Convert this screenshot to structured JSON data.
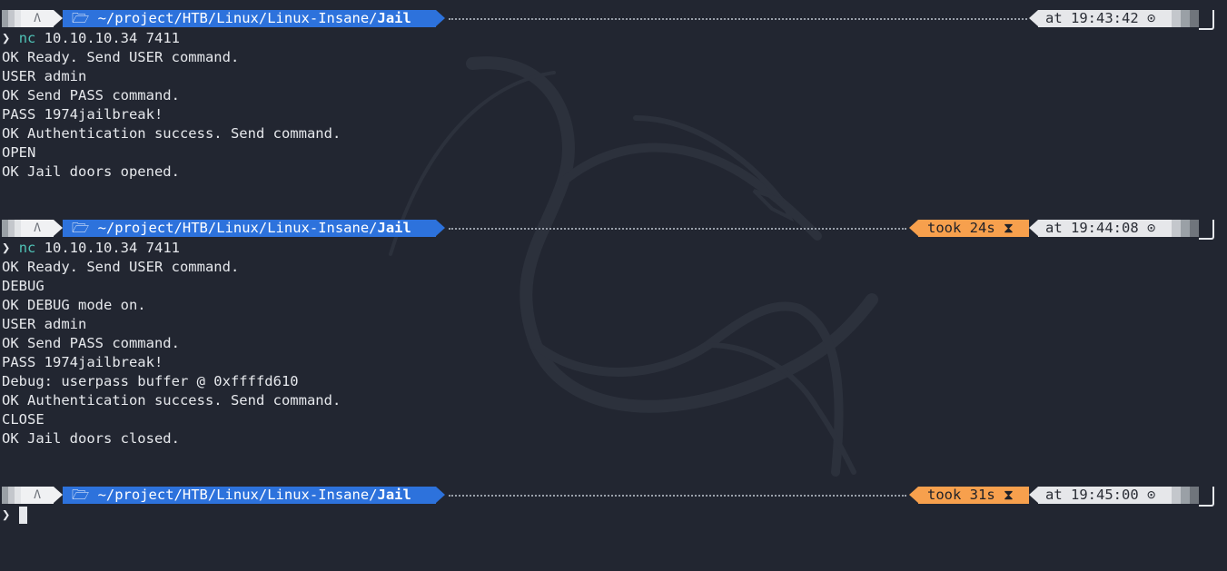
{
  "prompt": {
    "os_icon": "linux-tux-icon",
    "folder_icon": "folder-open-icon",
    "path_prefix": "~/project/HTB/Linux/Linux-Insane/",
    "path_dir": "Jail",
    "chevron": "❯"
  },
  "blocks": [
    {
      "time": "at 19:43:42 ⊙",
      "took": "",
      "command": "nc",
      "args": " 10.10.10.34 7411",
      "output": [
        "OK Ready. Send USER command.",
        "USER admin",
        "OK Send PASS command.",
        "PASS 1974jailbreak!",
        "OK Authentication success. Send command.",
        "OPEN",
        "OK Jail doors opened."
      ]
    },
    {
      "time": "at 19:44:08 ⊙",
      "took": "took 24s ⧗",
      "command": "nc",
      "args": " 10.10.10.34 7411",
      "output": [
        "OK Ready. Send USER command.",
        "DEBUG",
        "OK DEBUG mode on.",
        "USER admin",
        "OK Send PASS command.",
        "PASS 1974jailbreak!",
        "Debug: userpass buffer @ 0xffffd610",
        "OK Authentication success. Send command.",
        "CLOSE",
        "OK Jail doors closed."
      ]
    },
    {
      "time": "at 19:45:00 ⊙",
      "took": "took 31s ⧗",
      "command": "",
      "args": "",
      "output": []
    }
  ],
  "colors": {
    "background": "#222631",
    "path_segment": "#2d72dc",
    "took_segment": "#f7a04d",
    "time_segment": "#e6e7ea",
    "command_accent": "#4fc1b5"
  }
}
